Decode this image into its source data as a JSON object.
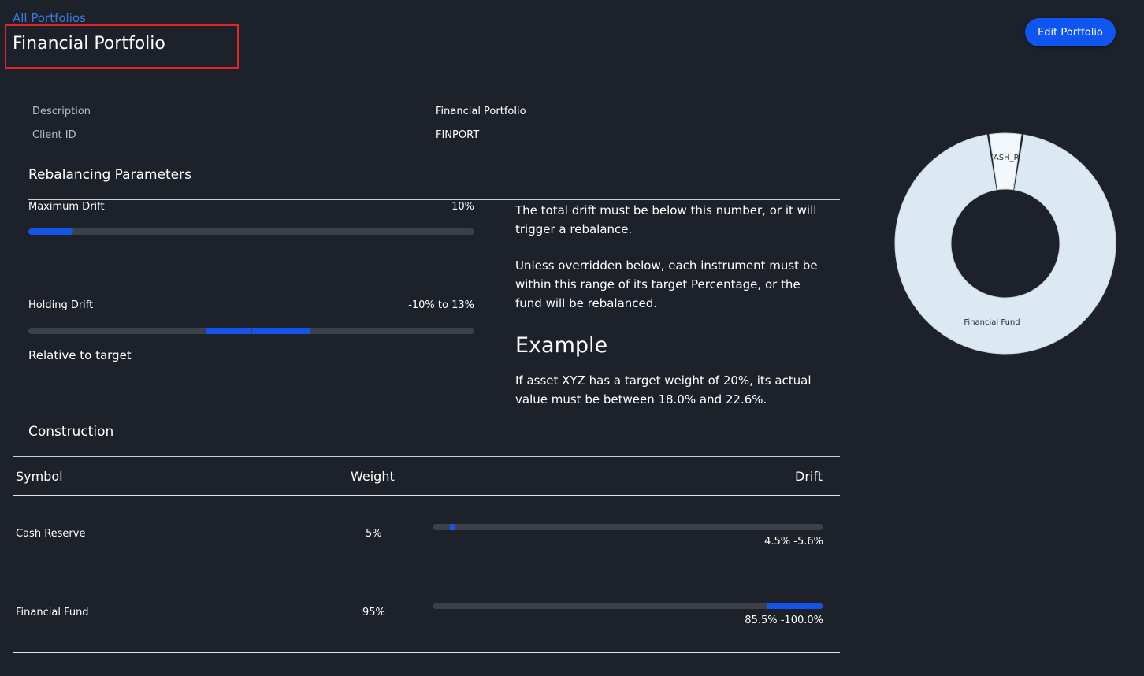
{
  "header": {
    "back_link": "All Portfolios",
    "title": "Financial Portfolio",
    "edit_button": "Edit Portfolio"
  },
  "info": {
    "description_label": "Description",
    "description_value": "Financial Portfolio",
    "client_id_label": "Client ID",
    "client_id_value": "FINPORT"
  },
  "rebalancing": {
    "title": "Rebalancing Parameters",
    "max_drift_label": "Maximum Drift",
    "max_drift_value": "10%",
    "max_drift_fraction": 0.1,
    "holding_drift_label": "Holding Drift",
    "holding_drift_value": "-10% to 13%",
    "holding_drift_lower": -10,
    "holding_drift_upper": 13,
    "relative_label": "Relative to target",
    "max_drift_desc": "The total drift must be below this number, or it will trigger a rebalance.",
    "holding_drift_desc": "Unless overridden below, each instrument must be within this range of its target Percentage, or the fund will be rebalanced.",
    "example_title": "Example",
    "example_text": "If asset XYZ has a target weight of 20%, its actual value must be between 18.0% and 22.6%."
  },
  "construction": {
    "title": "Construction",
    "columns": {
      "symbol": "Symbol",
      "weight": "Weight",
      "drift": "Drift"
    },
    "rows": [
      {
        "symbol": "Cash Reserve",
        "weight": "5%",
        "range": "4.5% -5.6%",
        "low": 4.5,
        "high": 5.6
      },
      {
        "symbol": "Financial Fund",
        "weight": "95%",
        "range": "85.5% -100.0%",
        "low": 85.5,
        "high": 100.0
      }
    ]
  },
  "allocation_chart": {
    "slices": [
      {
        "label": "CASH_RESERVE",
        "value": 5,
        "color": "#f3f8fc"
      },
      {
        "label": "Financial Fund",
        "value": 95,
        "color": "#dce8f2"
      }
    ]
  },
  "colors": {
    "background": "#1c212a",
    "accent": "#0f56f0",
    "highlight_border": "#e0252a"
  }
}
